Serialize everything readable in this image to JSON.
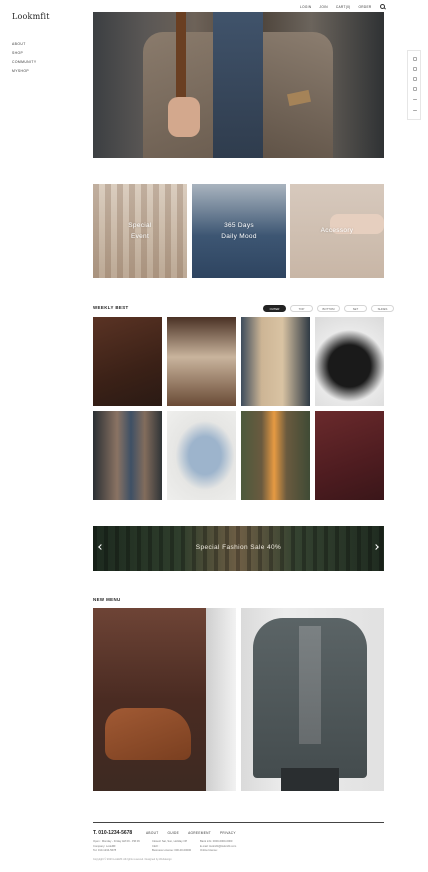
{
  "site": {
    "logo": "Lookmfit"
  },
  "left_nav": [
    "ABOUT",
    "SHOP",
    "COMMUNITY",
    "MYSHOP"
  ],
  "top_nav": [
    "LOGIN",
    "JOIN",
    "CART(0)",
    "ORDER"
  ],
  "promos": [
    {
      "line1": "Special",
      "line2": "Event"
    },
    {
      "line1": "365 Days",
      "line2": "Daily Mood"
    },
    {
      "line1": "Accessory",
      "line2": ""
    }
  ],
  "weekly_best": {
    "title": "WEEKLY BEST",
    "tabs": [
      "OUTER",
      "TOP",
      "BOTTOM",
      "SET",
      "SHOES"
    ],
    "active_tab": "OUTER"
  },
  "banner": {
    "text": "Special Fashion Sale 40%"
  },
  "new_menu": {
    "title": "NEW MENU"
  },
  "footer": {
    "phone": "T. 010-1234-5678",
    "nav": [
      "ABOUT",
      "GUIDE",
      "AGREEMENT",
      "PRIVACY"
    ],
    "info_col1": [
      "Open : Monday - Friday AM 09 - PM 06",
      "Company: LookMF",
      "Tel. 010-1234-5678"
    ],
    "info_col2": [
      "Closed: Sat, Sun, Holiday Off",
      "CEO : ",
      "Business License: 000-00-00000"
    ],
    "info_col3": [
      "Bank info: 0000-0000-0000",
      "E-mail: lookmfit@lookmfit.com",
      "Online license: "
    ],
    "copyright": "Copyright © 2023 LookMF. All rights reserved. Designed by Webdesign"
  },
  "colors": {
    "accent": "#222222",
    "tab_active_bg": "#222222",
    "footer_line": "#444444"
  }
}
